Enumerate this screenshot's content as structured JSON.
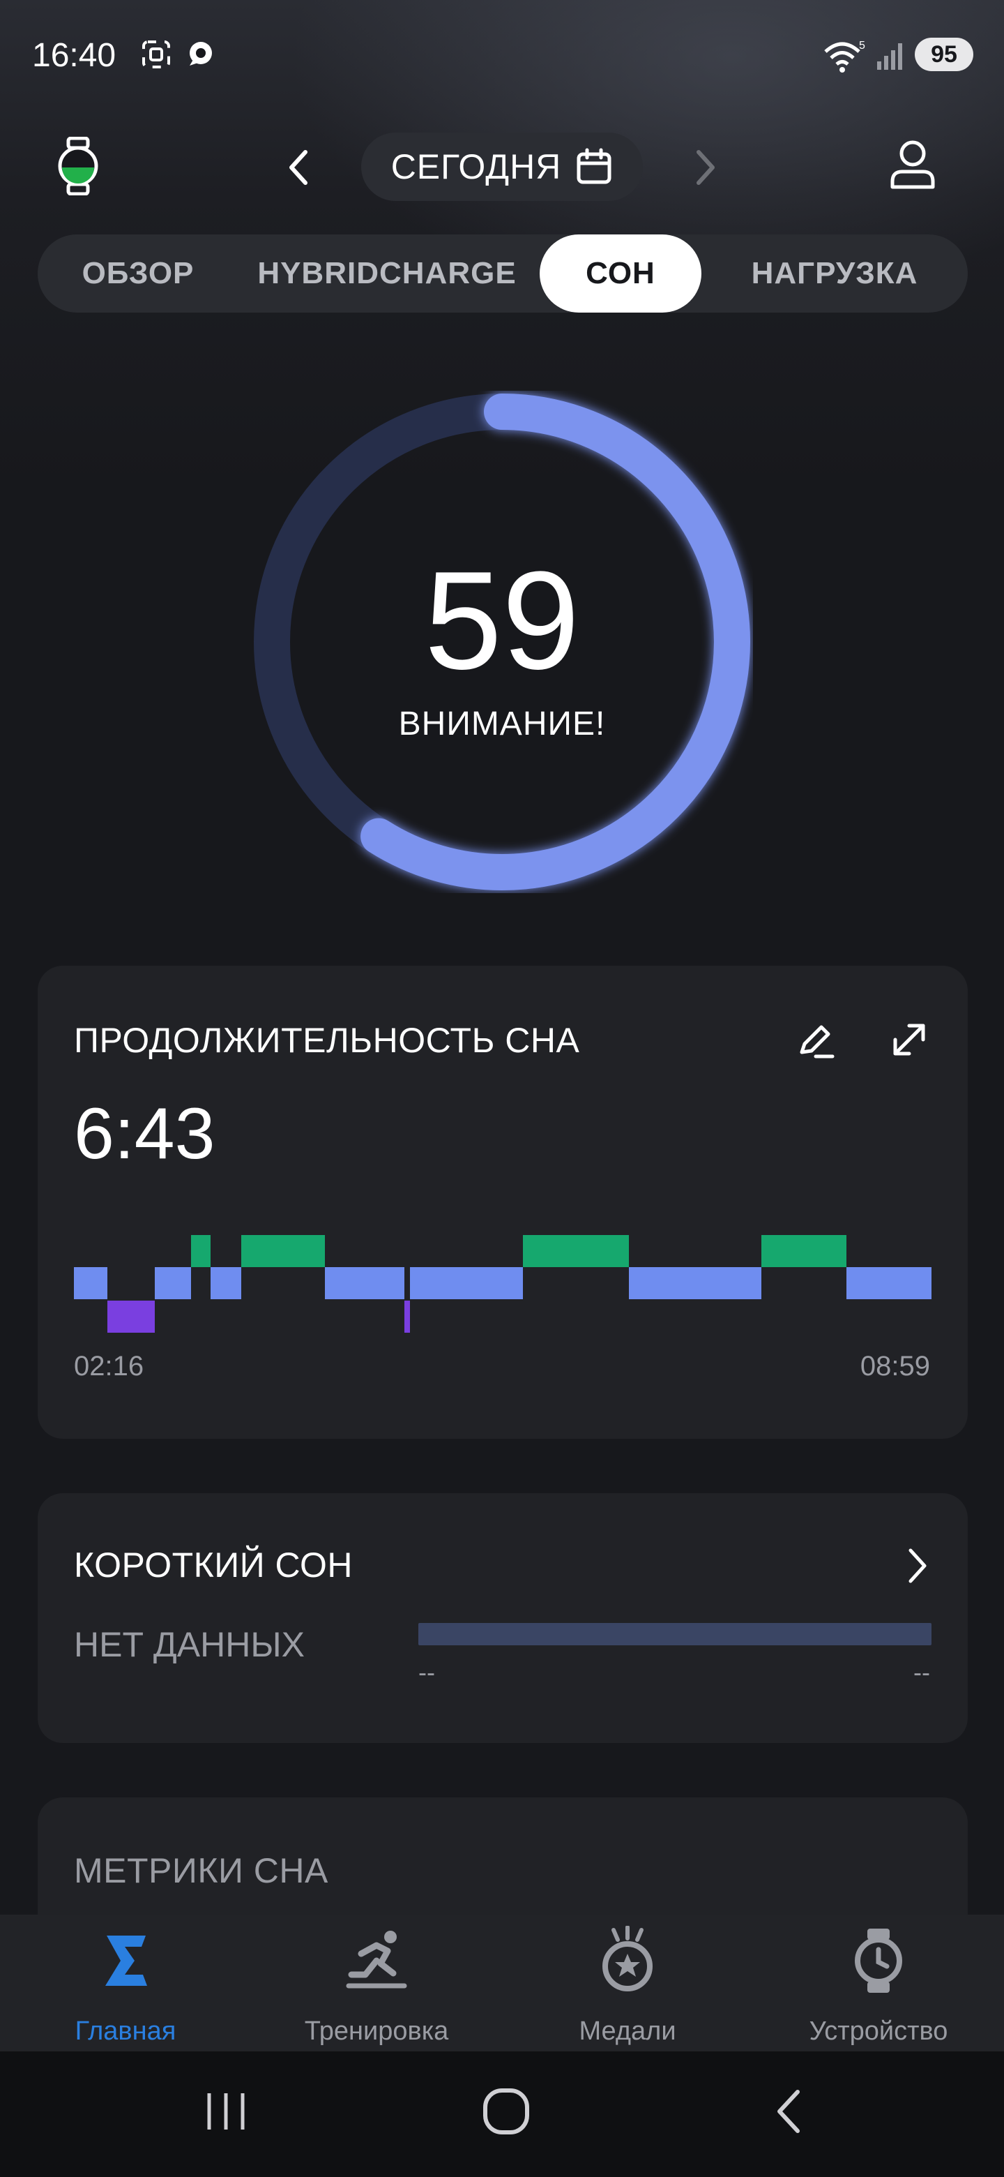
{
  "status_bar": {
    "time": "16:40",
    "battery": "95"
  },
  "header": {
    "date_label": "СЕГОДНЯ"
  },
  "tabs": [
    {
      "label": "ОБЗОР",
      "active": false
    },
    {
      "label": "HYBRIDCHARGE",
      "active": false
    },
    {
      "label": "СОН",
      "active": true
    },
    {
      "label": "НАГРУЗКА",
      "active": false
    }
  ],
  "score": {
    "value": "59",
    "label": "ВНИМАНИЕ!",
    "ring_fraction": 0.59,
    "ring_color": "#7b93ee"
  },
  "sleep_duration": {
    "title": "ПРОДОЛЖИТЕЛЬНОСТЬ СНА",
    "value": "6:43",
    "start_time": "02:16",
    "end_time": "08:59",
    "colors": {
      "awake": "#16a86e",
      "light": "#6f8df0",
      "deep": "#7a3fe0"
    }
  },
  "nap": {
    "title": "КОРОТКИЙ СОН",
    "status": "НЕТ ДАННЫХ",
    "range_start": "--",
    "range_end": "--"
  },
  "metrics": {
    "title": "МЕТРИКИ СНА"
  },
  "bottom_nav": [
    {
      "label": "Главная",
      "icon": "sigma-icon",
      "active": true
    },
    {
      "label": "Тренировка",
      "icon": "runner-icon",
      "active": false
    },
    {
      "label": "Медали",
      "icon": "medal-icon",
      "active": false
    },
    {
      "label": "Устройство",
      "icon": "watch-icon",
      "active": false
    }
  ],
  "accent_color": "#2a7fe0"
}
